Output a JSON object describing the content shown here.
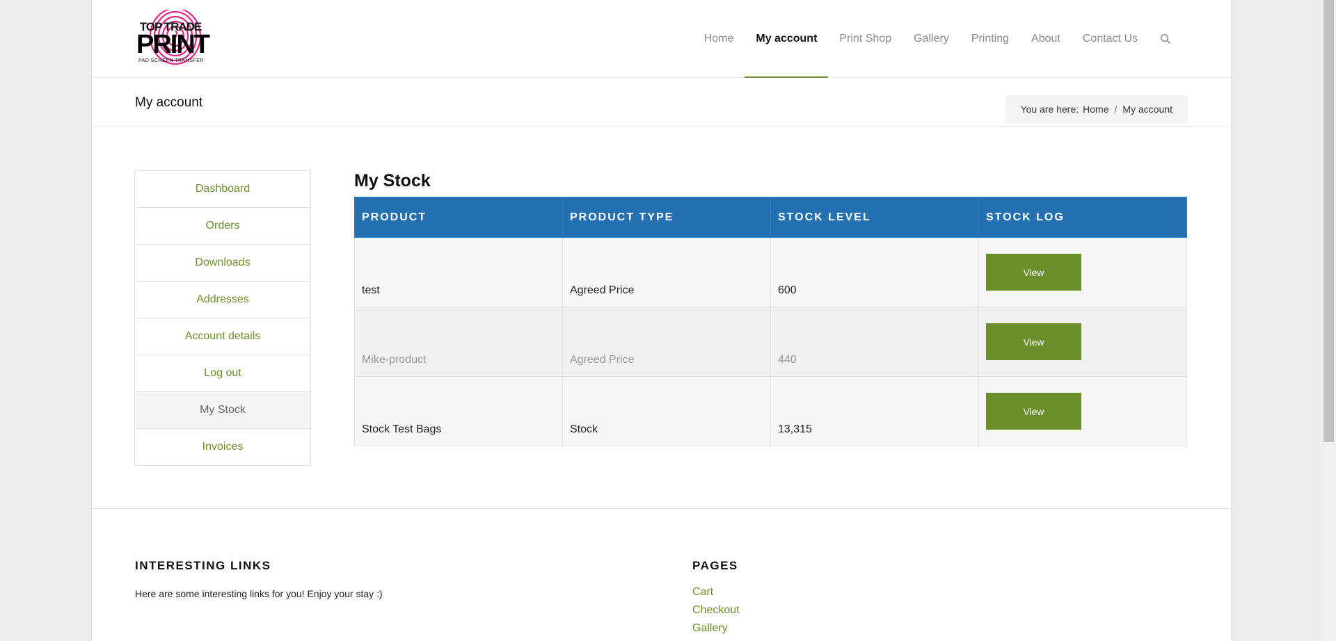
{
  "brand": {
    "logo_top": "TOP TRADE",
    "logo_main": "PRINT",
    "logo_sub": "PAD SCREEN TRANSFER"
  },
  "nav": {
    "items": [
      "Home",
      "My account",
      "Print Shop",
      "Gallery",
      "Printing",
      "About",
      "Contact Us"
    ],
    "active": "My account",
    "search_icon": "search-icon"
  },
  "titlebar": {
    "title": "My account",
    "breadcrumb_prefix": "You are here:",
    "breadcrumb_home": "Home",
    "breadcrumb_sep": "/",
    "breadcrumb_current": "My account"
  },
  "sidebar": {
    "items": [
      "Dashboard",
      "Orders",
      "Downloads",
      "Addresses",
      "Account details",
      "Log out",
      "My Stock",
      "Invoices"
    ],
    "active": "My Stock"
  },
  "main": {
    "title": "My Stock",
    "columns": [
      "PRODUCT",
      "PRODUCT TYPE",
      "STOCK LEVEL",
      "STOCK LOG"
    ],
    "rows": [
      {
        "product": "test",
        "type": "Agreed Price",
        "level": "600",
        "action": "View"
      },
      {
        "product": "Mike-product",
        "type": "Agreed Price",
        "level": "440",
        "action": "View"
      },
      {
        "product": "Stock Test Bags",
        "type": "Stock",
        "level": "13,315",
        "action": "View"
      }
    ]
  },
  "footer": {
    "left_title": "INTERESTING LINKS",
    "left_text": "Here are some interesting links for you! Enjoy your stay :)",
    "right_title": "PAGES",
    "links": [
      "Cart",
      "Checkout",
      "Gallery"
    ]
  },
  "colors": {
    "accent_green": "#6a8f2a",
    "table_header_blue": "#2470b1",
    "logo_pink": "#e0288a"
  }
}
